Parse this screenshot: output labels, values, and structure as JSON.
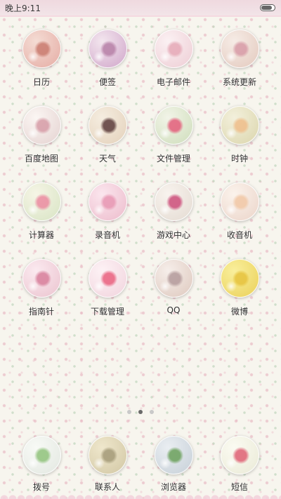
{
  "status_bar": {
    "time": "晚上9:11",
    "battery_level": 0.85
  },
  "pager": {
    "page_count": 3,
    "active_page": 2
  },
  "apps": [
    {
      "label": "日历",
      "icon": "calendar-icon",
      "colors": [
        "#e9b8b0",
        "#f4dcd4",
        "#c97a6e"
      ]
    },
    {
      "label": "便签",
      "icon": "notes-icon",
      "colors": [
        "#d9b6d3",
        "#f3e6ee",
        "#b67fa6"
      ]
    },
    {
      "label": "电子邮件",
      "icon": "email-icon",
      "colors": [
        "#f1d6dc",
        "#fbf1f3",
        "#e5a8b6"
      ]
    },
    {
      "label": "系统更新",
      "icon": "system-update-icon",
      "colors": [
        "#e8d2c8",
        "#f6ece6",
        "#d79aa6"
      ]
    },
    {
      "label": "百度地图",
      "icon": "baidu-map-icon",
      "colors": [
        "#eadbd9",
        "#fbf6f3",
        "#d69ba6"
      ]
    },
    {
      "label": "天气",
      "icon": "weather-icon",
      "colors": [
        "#e8d8c4",
        "#f5ede0",
        "#5b3b3a"
      ]
    },
    {
      "label": "文件管理",
      "icon": "file-manager-icon",
      "colors": [
        "#d7e3c6",
        "#f2f4e8",
        "#e35d7a"
      ]
    },
    {
      "label": "时钟",
      "icon": "clock-icon",
      "colors": [
        "#e1dcb8",
        "#f3f0dc",
        "#efbd8a"
      ]
    },
    {
      "label": "计算器",
      "icon": "calculator-icon",
      "colors": [
        "#dfe8cc",
        "#f6f5e6",
        "#eb8aa0"
      ]
    },
    {
      "label": "录音机",
      "icon": "recorder-icon",
      "colors": [
        "#f0c6d4",
        "#fbe6ee",
        "#e796b2"
      ]
    },
    {
      "label": "游戏中心",
      "icon": "game-center-icon",
      "colors": [
        "#e9e1d9",
        "#f8f3ee",
        "#cc4d7a"
      ]
    },
    {
      "label": "收音机",
      "icon": "radio-icon",
      "colors": [
        "#efdcd2",
        "#fbf3ec",
        "#f1c7a5"
      ]
    },
    {
      "label": "指南针",
      "icon": "compass-icon",
      "colors": [
        "#efcdd7",
        "#fbeaf0",
        "#d77e9a"
      ]
    },
    {
      "label": "下载管理",
      "icon": "download-manager-icon",
      "colors": [
        "#f4dbe3",
        "#fdf2f5",
        "#e9607e"
      ]
    },
    {
      "label": "QQ",
      "icon": "qq-icon",
      "colors": [
        "#e4d2c9",
        "#f6eeea",
        "#b39a9b"
      ]
    },
    {
      "label": "微博",
      "icon": "weibo-icon",
      "colors": [
        "#eed86a",
        "#f9ef9c",
        "#e6c23d"
      ]
    }
  ],
  "dock": [
    {
      "label": "拨号",
      "icon": "phone-dialer-icon",
      "colors": [
        "#e8ece6",
        "#f8faf6",
        "#8fc27a"
      ]
    },
    {
      "label": "联系人",
      "icon": "contacts-icon",
      "colors": [
        "#d9cfae",
        "#efe7cc",
        "#a49a78"
      ]
    },
    {
      "label": "浏览器",
      "icon": "browser-icon",
      "colors": [
        "#cfd7de",
        "#eaeef2",
        "#6aa05a"
      ]
    },
    {
      "label": "短信",
      "icon": "messages-icon",
      "colors": [
        "#eeeedd",
        "#fbfbf2",
        "#df5f73"
      ]
    }
  ]
}
